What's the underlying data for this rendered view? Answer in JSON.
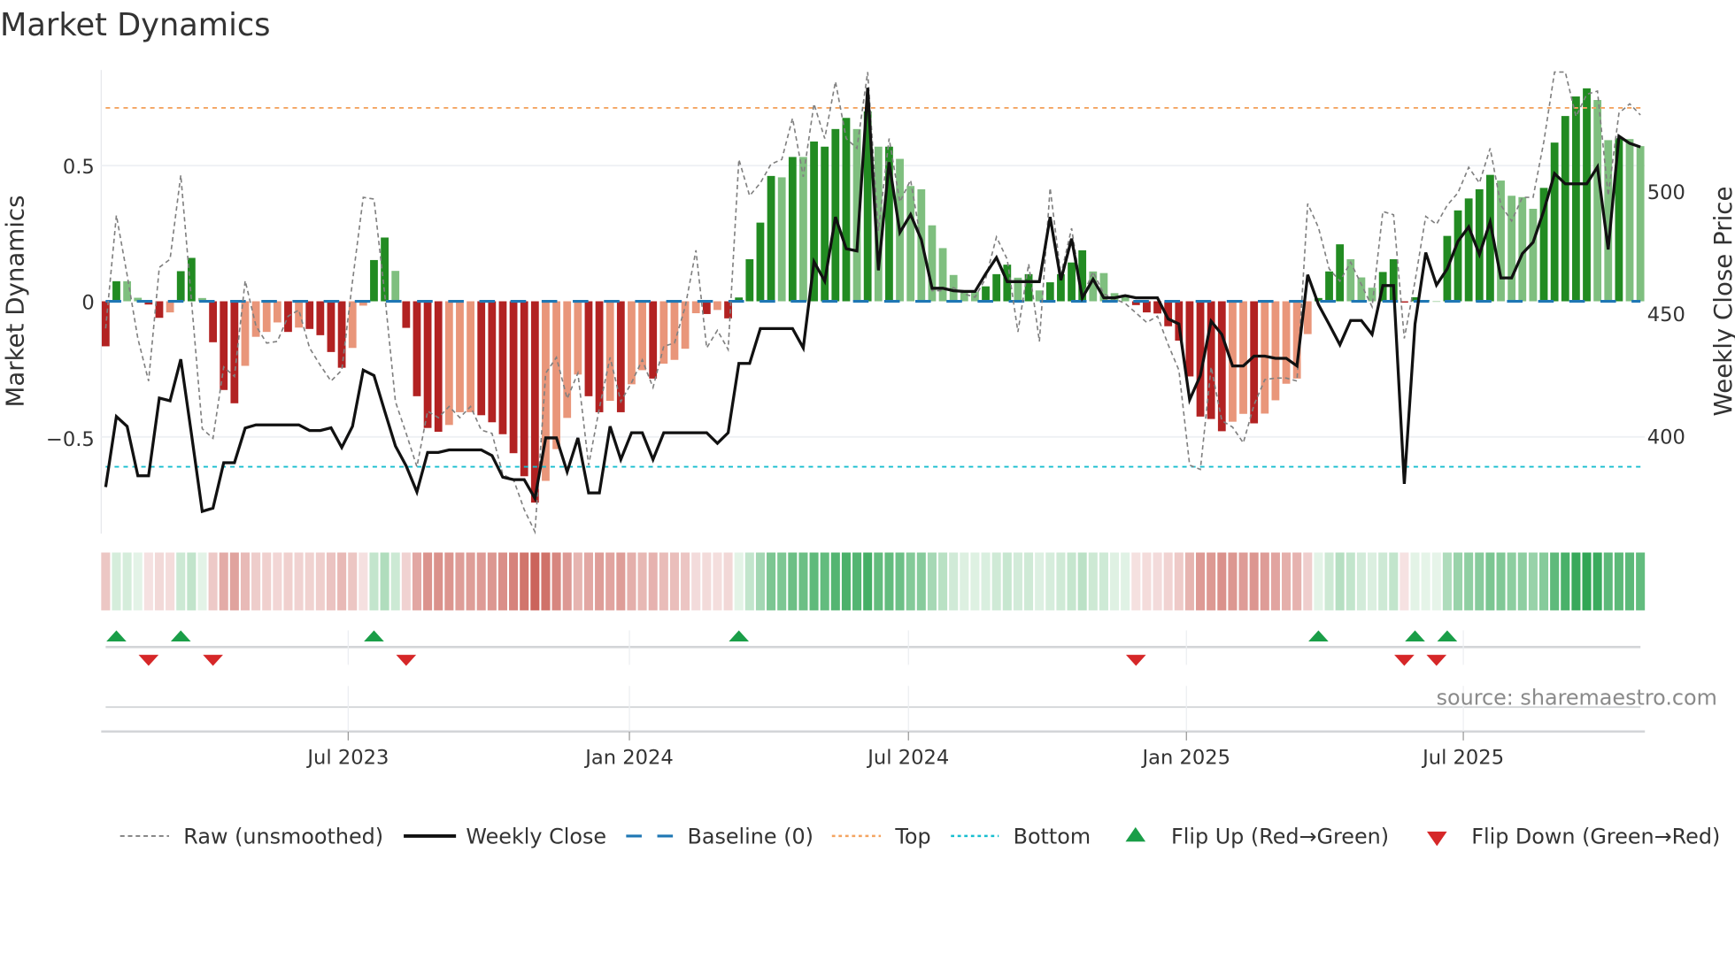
{
  "chart_data": {
    "type": "bar",
    "title": "Market Dynamics",
    "ylabel": "Market Dynamics",
    "y2label": "Weekly Close Price",
    "ylim": [
      -0.857,
      0.852
    ],
    "y2lim": [
      360.6,
      549.3
    ],
    "yticks": [
      {
        "value": 0.5,
        "label": "0.5"
      },
      {
        "value": 0,
        "label": "0"
      },
      {
        "value": -0.5,
        "label": "−0.5"
      }
    ],
    "y2ticks": [
      {
        "value": 500,
        "label": "500"
      },
      {
        "value": 450,
        "label": "450"
      },
      {
        "value": 400,
        "label": "400"
      }
    ],
    "xticks": [
      {
        "week": 22.6,
        "label": "Jul 2023"
      },
      {
        "week": 48.8,
        "label": "Jan 2024"
      },
      {
        "week": 74.8,
        "label": "Jul 2024"
      },
      {
        "week": 100.7,
        "label": "Jan 2025"
      },
      {
        "week": 126.5,
        "label": "Jul 2025"
      }
    ],
    "top_level": 0.713,
    "bottom_level": -0.61,
    "baseline": 0,
    "dynamics": [
      -0.166,
      0.074,
      0.074,
      0.013,
      -0.012,
      -0.061,
      -0.041,
      0.111,
      0.16,
      0.012,
      -0.151,
      -0.327,
      -0.376,
      -0.238,
      -0.131,
      -0.113,
      -0.078,
      -0.113,
      -0.097,
      -0.102,
      -0.125,
      -0.187,
      -0.245,
      -0.172,
      -0.016,
      0.152,
      0.235,
      0.112,
      -0.098,
      -0.35,
      -0.467,
      -0.481,
      -0.456,
      -0.409,
      -0.409,
      -0.42,
      -0.446,
      -0.49,
      -0.56,
      -0.645,
      -0.742,
      -0.662,
      -0.545,
      -0.43,
      -0.27,
      -0.35,
      -0.409,
      -0.367,
      -0.409,
      -0.306,
      -0.254,
      -0.285,
      -0.23,
      -0.216,
      -0.175,
      -0.044,
      -0.047,
      -0.032,
      -0.063,
      0.014,
      0.155,
      0.29,
      0.462,
      0.457,
      0.532,
      0.532,
      0.589,
      0.57,
      0.635,
      0.676,
      0.635,
      0.7,
      0.57,
      0.57,
      0.525,
      0.425,
      0.413,
      0.28,
      0.196,
      0.097,
      0.041,
      0.035,
      0.055,
      0.1,
      0.135,
      0.087,
      0.1,
      0.04,
      0.07,
      0.1,
      0.143,
      0.188,
      0.11,
      0.104,
      0.03,
      0.024,
      -0.014,
      -0.041,
      -0.045,
      -0.092,
      -0.145,
      -0.277,
      -0.425,
      -0.434,
      -0.479,
      -0.444,
      -0.415,
      -0.45,
      -0.414,
      -0.365,
      -0.304,
      -0.285,
      -0.121,
      0.012,
      0.11,
      0.21,
      0.155,
      0.088,
      0.05,
      0.108,
      0.155,
      -0.005,
      0.015,
      0.005,
      0.0,
      0.241,
      0.335,
      0.379,
      0.413,
      0.466,
      0.445,
      0.389,
      0.384,
      0.341,
      0.418,
      0.585,
      0.683,
      0.755,
      0.785,
      0.742,
      0.594,
      0.601,
      0.598,
      0.572
    ],
    "strong": [
      1,
      1,
      0,
      0,
      1,
      1,
      0,
      1,
      1,
      0,
      1,
      1,
      1,
      0,
      0,
      0,
      0,
      1,
      0,
      1,
      1,
      1,
      1,
      0,
      0,
      1,
      1,
      0,
      1,
      1,
      1,
      1,
      0,
      0,
      0,
      1,
      1,
      1,
      1,
      1,
      1,
      0,
      0,
      0,
      0,
      1,
      1,
      0,
      1,
      0,
      0,
      1,
      0,
      0,
      0,
      0,
      1,
      0,
      1,
      1,
      1,
      1,
      1,
      0,
      1,
      0,
      1,
      1,
      1,
      1,
      0,
      1,
      0,
      1,
      0,
      0,
      0,
      0,
      0,
      0,
      0,
      0,
      1,
      1,
      1,
      0,
      1,
      0,
      1,
      1,
      1,
      1,
      0,
      0,
      0,
      0,
      1,
      1,
      1,
      1,
      1,
      1,
      1,
      1,
      1,
      0,
      0,
      1,
      0,
      0,
      0,
      0,
      0,
      1,
      1,
      1,
      0,
      0,
      0,
      1,
      1,
      1,
      1,
      0,
      0,
      1,
      1,
      1,
      1,
      1,
      0,
      0,
      0,
      0,
      1,
      1,
      1,
      1,
      1,
      0,
      0,
      1,
      0,
      0
    ],
    "raw": [
      -0.1,
      0.317,
      0.097,
      -0.137,
      -0.294,
      0.125,
      0.155,
      0.465,
      0.0,
      -0.47,
      -0.505,
      -0.242,
      -0.277,
      0.076,
      -0.09,
      -0.154,
      -0.148,
      -0.055,
      -0.032,
      -0.172,
      -0.236,
      -0.294,
      -0.254,
      0.074,
      0.383,
      0.377,
      0.027,
      -0.37,
      -0.487,
      -0.61,
      -0.405,
      -0.429,
      -0.388,
      -0.429,
      -0.388,
      -0.475,
      -0.487,
      -0.639,
      -0.657,
      -0.768,
      -0.85,
      -0.265,
      -0.207,
      -0.359,
      -0.265,
      -0.604,
      -0.394,
      -0.207,
      -0.37,
      -0.3,
      -0.216,
      -0.318,
      -0.166,
      -0.154,
      -0.02,
      0.188,
      -0.172,
      -0.107,
      -0.178,
      0.523,
      0.389,
      0.436,
      0.506,
      0.523,
      0.675,
      0.459,
      0.728,
      0.6,
      0.81,
      0.6,
      0.564,
      0.845,
      0.26,
      0.6,
      0.366,
      0.447,
      0.214,
      0.039,
      0.039,
      0.05,
      0.027,
      0.015,
      0.085,
      0.237,
      0.155,
      -0.113,
      0.138,
      -0.148,
      0.418,
      0.097,
      0.269,
      0.015,
      0.109,
      0.027,
      0.009,
      -0.008,
      -0.043,
      -0.078,
      -0.055,
      -0.16,
      -0.254,
      -0.604,
      -0.62,
      -0.242,
      -0.44,
      -0.464,
      -0.522,
      -0.382,
      -0.289,
      -0.283,
      -0.283,
      -0.294,
      0.36,
      0.272,
      0.12,
      0.074,
      0.144,
      0.062,
      -0.02,
      0.331,
      0.319,
      -0.137,
      0.074,
      0.313,
      0.284,
      0.354,
      0.4,
      0.494,
      0.436,
      0.564,
      0.354,
      0.296,
      0.383,
      0.383,
      0.588,
      0.845,
      0.845,
      0.681,
      0.763,
      0.775,
      0.389,
      0.693,
      0.728,
      0.687
    ],
    "weekly_close": [
      379.6,
      408.3,
      404.3,
      384.2,
      384.2,
      415.8,
      414.7,
      431.6,
      401,
      369.7,
      371,
      389.5,
      389.5,
      403.6,
      404.9,
      404.9,
      404.9,
      404.9,
      404.9,
      402.6,
      402.6,
      403.7,
      395.7,
      404.3,
      427.2,
      425,
      410.5,
      396.3,
      388.2,
      377.6,
      393.7,
      393.7,
      394.7,
      394.7,
      394.7,
      394.7,
      392.4,
      383.6,
      382.6,
      382.6,
      375,
      399.6,
      399.6,
      385.8,
      399.6,
      377.2,
      377.2,
      404.3,
      390.8,
      401.7,
      401.7,
      390.8,
      401.7,
      401.7,
      401.7,
      401.7,
      401.7,
      397.4,
      401.7,
      429.9,
      429.9,
      444.1,
      444.1,
      444.1,
      444.1,
      436.2,
      471.3,
      463.4,
      489.5,
      476.6,
      475.7,
      542.1,
      467.8,
      511.8,
      483.2,
      490.5,
      480.3,
      460.5,
      460.5,
      459.5,
      459.2,
      459.2,
      466.4,
      473,
      463.2,
      463.2,
      463.2,
      463.2,
      489.5,
      463.8,
      480.7,
      456.6,
      464.2,
      456.6,
      456.6,
      457.5,
      456.6,
      456.6,
      456.6,
      448,
      446,
      415.1,
      425,
      447.1,
      441.7,
      428.9,
      428.9,
      432.9,
      432.9,
      432,
      432,
      428.9,
      466,
      453.9,
      445.8,
      437.5,
      447.4,
      447.4,
      441.7,
      461.6,
      461.6,
      380.9,
      446,
      475,
      461.8,
      468.4,
      479.6,
      485.5,
      474.3,
      487.5,
      464.7,
      464.7,
      474.6,
      479.2,
      492.1,
      507.2,
      503,
      503,
      503,
      509.9,
      476.3,
      522.4,
      519.5,
      518
    ],
    "flip_up_weeks": [
      1,
      7,
      25,
      59,
      113,
      122,
      125
    ],
    "flip_down_weeks": [
      4,
      10,
      28,
      96,
      121,
      124
    ],
    "legend": {
      "placement": "bottom",
      "items": [
        {
          "key": "raw",
          "label": "Raw (unsmoothed)"
        },
        {
          "key": "close",
          "label": "Weekly Close"
        },
        {
          "key": "baseline",
          "label": "Baseline (0)"
        },
        {
          "key": "top",
          "label": "Top"
        },
        {
          "key": "bottom",
          "label": "Bottom"
        },
        {
          "key": "flipup",
          "label": "Flip Up (Red→Green)"
        },
        {
          "key": "flipdown",
          "label": "Flip Down (Green→Red)"
        }
      ]
    },
    "source": "source: sharemaestro.com",
    "colors": {
      "strong_green": "#228b22",
      "weak_green": "#7fbf7f",
      "strong_red": "#b22222",
      "weak_red": "#e9967a",
      "baseline": "#1f77b4",
      "top": "#f4a460",
      "bottom": "#17becf",
      "close": "#111111",
      "raw": "#808080",
      "flip_up": "#1a9e48",
      "flip_down": "#d62728"
    }
  }
}
